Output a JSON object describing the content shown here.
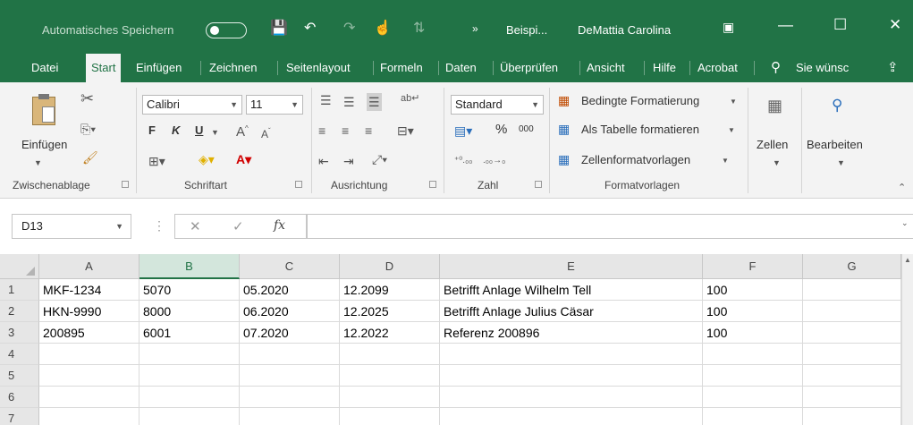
{
  "titlebar": {
    "autosave_label": "Automatisches Speichern",
    "document_name": "Beispi...",
    "user_name": "DeMattia Carolina"
  },
  "tabs": [
    "Datei",
    "Start",
    "Einfügen",
    "Zeichnen",
    "Seitenlayout",
    "Formeln",
    "Daten",
    "Überprüfen",
    "Ansicht",
    "Hilfe",
    "Acrobat"
  ],
  "search_placeholder": "Sie wünsc",
  "ribbon": {
    "paste_label": "Einfügen",
    "clipboard_group": "Zwischenablage",
    "font_name": "Calibri",
    "font_size": "11",
    "bold": "F",
    "italic": "K",
    "underline": "U",
    "font_group": "Schriftart",
    "alignment_group": "Ausrichtung",
    "number_format": "Standard",
    "percent": "%",
    "thousands": "000",
    "number_group": "Zahl",
    "conditional_formatting": "Bedingte Formatierung",
    "format_as_table": "Als Tabelle formatieren",
    "cell_styles": "Zellenformatvorlagen",
    "styles_group": "Formatvorlagen",
    "cells_label": "Zellen",
    "editing_label": "Bearbeiten"
  },
  "name_box": "D13",
  "columns": [
    "A",
    "B",
    "C",
    "D",
    "E",
    "F",
    "G"
  ],
  "rows": [
    {
      "num": "1",
      "cells": [
        "MKF-1234",
        "5070",
        "05.2020",
        "12.2099",
        "Betrifft Anlage Wilhelm Tell",
        "100",
        ""
      ]
    },
    {
      "num": "2",
      "cells": [
        "HKN-9990",
        "8000",
        "06.2020",
        "12.2025",
        "Betrifft Anlage Julius Cäsar",
        "100",
        ""
      ]
    },
    {
      "num": "3",
      "cells": [
        "200895",
        "6001",
        "07.2020",
        "12.2022",
        "Referenz 200896",
        "100",
        ""
      ]
    },
    {
      "num": "4",
      "cells": [
        "",
        "",
        "",
        "",
        "",
        "",
        ""
      ]
    },
    {
      "num": "5",
      "cells": [
        "",
        "",
        "",
        "",
        "",
        "",
        ""
      ]
    },
    {
      "num": "6",
      "cells": [
        "",
        "",
        "",
        "",
        "",
        "",
        ""
      ]
    },
    {
      "num": "7",
      "cells": [
        "",
        "",
        "",
        "",
        "",
        "",
        ""
      ]
    }
  ],
  "colors": {
    "accent": "#217346",
    "ribbon_bg": "#f3f3f3"
  }
}
